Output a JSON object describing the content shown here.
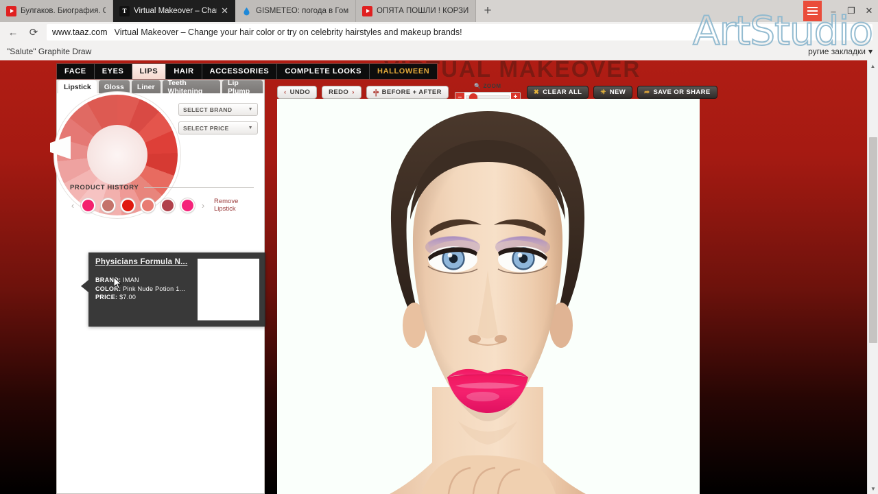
{
  "browser": {
    "tabs": [
      {
        "title": "Булгаков. Биография. Скры",
        "favicon": "youtube-icon",
        "active": false
      },
      {
        "title": "Virtual Makeover – Chang",
        "favicon": "taaz-icon",
        "active": true
      },
      {
        "title": "GISMETEO: погода в Гомел",
        "favicon": "gismeteo-icon",
        "active": false
      },
      {
        "title": "ОПЯТА ПОШЛИ ! КОРЗИН",
        "favicon": "youtube-icon",
        "active": false
      }
    ],
    "new_tab_label": "+",
    "close_tab_label": "✕",
    "window_controls": {
      "minimize": "–",
      "maximize": "❐",
      "close": "✕"
    },
    "omnibox": {
      "url": "www.taaz.com",
      "title": "Virtual Makeover – Change your hair color or try on celebrity hairstyles and makeup brands!",
      "back_icon": "back-arrow-icon",
      "reload_icon": "reload-icon"
    },
    "bookmarks": {
      "items": [
        {
          "label": "\"Salute\" Graphite Draw"
        }
      ],
      "other_label": "ругие закладки"
    }
  },
  "watermark": {
    "text": "ArtStudio",
    "color": "#8fb9cf"
  },
  "site": {
    "title": "VIRTUAL MAKEOVER",
    "main_nav": [
      {
        "label": "FACE",
        "active": false
      },
      {
        "label": "EYES",
        "active": false
      },
      {
        "label": "LIPS",
        "active": true
      },
      {
        "label": "HAIR",
        "active": false
      },
      {
        "label": "ACCESSORIES",
        "active": false
      },
      {
        "label": "COMPLETE LOOKS",
        "active": false
      },
      {
        "label": "HALLOWEEN",
        "active": false
      }
    ],
    "sub_tabs": [
      {
        "label": "Lipstick",
        "active": true
      },
      {
        "label": "Gloss",
        "active": false
      },
      {
        "label": "Liner",
        "active": false
      },
      {
        "label": "Teeth Whitening",
        "active": false
      },
      {
        "label": "Lip Plump",
        "active": false
      }
    ],
    "filters": [
      {
        "label": "SELECT BRAND"
      },
      {
        "label": "SELECT PRICE"
      }
    ],
    "tooltip": {
      "title": "Physicians Formula N...",
      "brand_label": "BRAND:",
      "brand_value": "IMAN",
      "color_label": "COLOR:",
      "color_value": "Pink Nude Potion 1...",
      "price_label": "PRICE:",
      "price_value": "$7.00"
    },
    "history": {
      "heading": "PRODUCT HISTORY",
      "prev_label": "‹",
      "next_label": "›",
      "remove_label_line1": "Remove",
      "remove_label_line2": "Lipstick",
      "swatches": [
        "#f4216e",
        "#c4736a",
        "#e0190e",
        "#e87b72",
        "#b0414b",
        "#f5237a"
      ]
    },
    "toolbar": {
      "undo": "UNDO",
      "undo_icon": "chevron-left-icon",
      "redo": "REDO",
      "redo_icon": "chevron-right-icon",
      "before_after": "BEFORE + AFTER",
      "before_after_icon": "split-view-icon",
      "zoom_label": "ZOOM",
      "zoom_icon": "magnifier-icon",
      "zoom_minus": "–",
      "zoom_plus": "+",
      "clear_all": "CLEAR ALL",
      "clear_all_icon": "x-icon",
      "new": "NEW",
      "new_icon": "sparkle-icon",
      "save_or_share": "SAVE OR SHARE",
      "save_icon": "share-icon"
    },
    "colors": {
      "accent_red": "#d9352a",
      "page_top": "#b01d14",
      "lipstick_applied": "#f4216e"
    }
  },
  "scrollbar": {
    "up": "▲",
    "down": "▼"
  }
}
